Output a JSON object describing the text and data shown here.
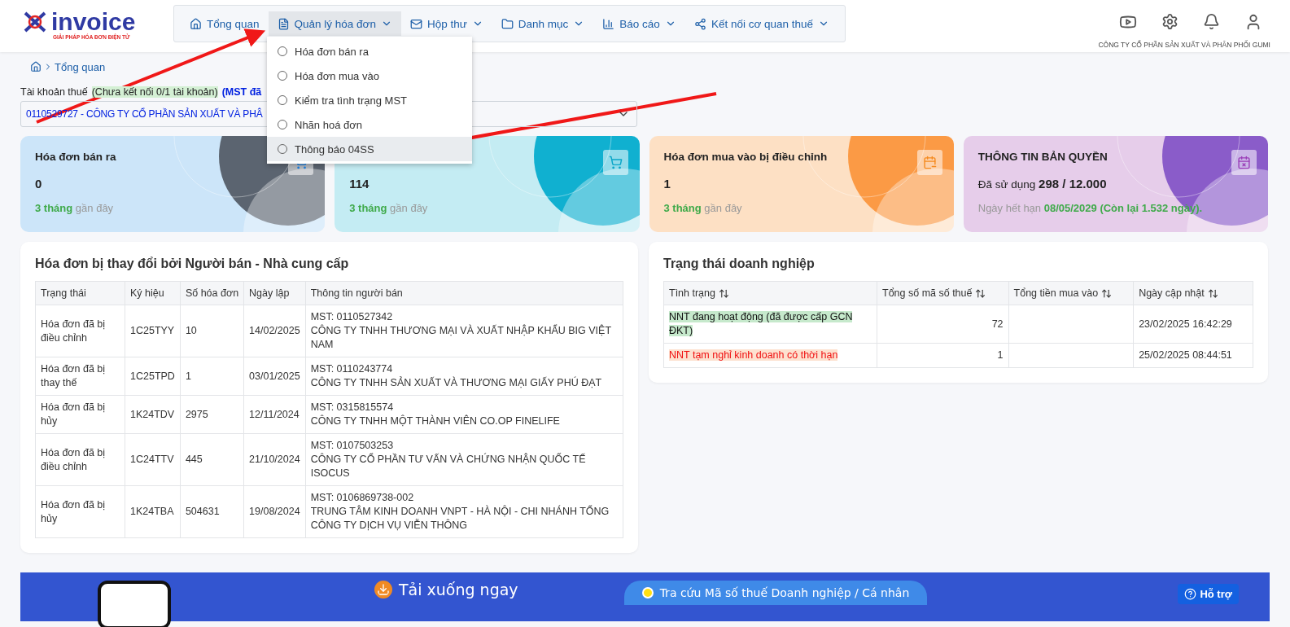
{
  "logo": {
    "name": "invoice",
    "tagline": "GIẢI PHÁP HÓA ĐƠN ĐIỆN TỬ"
  },
  "nav": [
    {
      "label": "Tổng quan",
      "selected": false,
      "dropdown": false
    },
    {
      "label": "Quản lý hóa đơn",
      "selected": true,
      "dropdown": true
    },
    {
      "label": "Hộp thư",
      "selected": false,
      "dropdown": true
    },
    {
      "label": "Danh mục",
      "selected": false,
      "dropdown": true
    },
    {
      "label": "Báo cáo",
      "selected": false,
      "dropdown": true
    },
    {
      "label": "Kết nối cơ quan thuế",
      "selected": false,
      "dropdown": true
    }
  ],
  "dropdown_menu": [
    {
      "label": "Hóa đơn bán ra",
      "selected": false
    },
    {
      "label": "Hóa đơn mua vào",
      "selected": false
    },
    {
      "label": "Kiểm tra tình trạng MST",
      "selected": false
    },
    {
      "label": "Nhãn hoá đơn",
      "selected": false
    },
    {
      "label": "Thông báo 04SS",
      "selected": true
    }
  ],
  "company_name": "CÔNG TY CỔ PHẦN SẢN XUẤT VÀ PHÂN PHỐI GUMI",
  "breadcrumb": "Tổng quan",
  "tax_account": {
    "label": "Tài khoản thuế",
    "connection": "(Chưa kết nối 0/1 tài khoản)",
    "mst_note": "(MST đã",
    "value": "0110529727 - CÔNG TY CỔ PHẦN SẢN XUẤT VÀ PHÂ"
  },
  "cards": [
    {
      "title": "Hóa đơn bán ra",
      "value": "0",
      "footer_highlight": "3 tháng",
      "footer_text": "gần đây",
      "color": "#cce5f9"
    },
    {
      "value": "114",
      "footer_highlight": "3 tháng",
      "footer_text": "gần đây",
      "color": "#c4ecf3"
    },
    {
      "title": "Hóa đơn mua vào bị điều chỉnh",
      "value": "1",
      "footer_highlight": "3 tháng",
      "footer_text": "gần đây",
      "color": "#fde0c4"
    },
    {
      "title": "THÔNG TIN BẢN QUYỀN",
      "value_prefix": "Đã sử dụng",
      "value": "298 / 12.000",
      "footer_text": "Ngày hết hạn",
      "footer_highlight": "08/05/2029 (Còn lại 1.532 ngày).",
      "color": "#e6cdea"
    }
  ],
  "changed_invoices": {
    "title": "Hóa đơn bị thay đổi bởi Người bán - Nhà cung cấp",
    "columns": [
      "Trạng thái",
      "Ký hiệu",
      "Số hóa đơn",
      "Ngày lập",
      "Thông tin người bán"
    ],
    "rows": [
      {
        "status": "Hóa đơn đã bị điều chỉnh",
        "symbol": "1C25TYY",
        "number": "10",
        "date": "14/02/2025",
        "mst": "MST: 0110527342",
        "seller": "CÔNG TY TNHH THƯƠNG MẠI VÀ XUẤT NHẬP KHẨU BIG VIỆT NAM"
      },
      {
        "status": "Hóa đơn đã bị thay thế",
        "symbol": "1C25TPD",
        "number": "1",
        "date": "03/01/2025",
        "mst": "MST: 0110243774",
        "seller": "CÔNG TY TNHH SẢN XUẤT VÀ THƯƠNG MẠI GIẤY PHÚ ĐẠT"
      },
      {
        "status": "Hóa đơn đã bị hủy",
        "symbol": "1K24TDV",
        "number": "2975",
        "date": "12/11/2024",
        "mst": "MST: 0315815574",
        "seller": "CÔNG TY TNHH MỘT THÀNH VIÊN CO.OP FINELIFE"
      },
      {
        "status": "Hóa đơn đã bị điều chỉnh",
        "symbol": "1C24TTV",
        "number": "445",
        "date": "21/10/2024",
        "mst": "MST: 0107503253",
        "seller": "CÔNG TY CỔ PHẦN TƯ VẤN VÀ CHỨNG NHẬN QUỐC TẾ ISOCUS"
      },
      {
        "status": "Hóa đơn đã bị hủy",
        "symbol": "1K24TBA",
        "number": "504631",
        "date": "19/08/2024",
        "mst": "MST: 0106869738-002",
        "seller": "TRUNG TÂM KINH DOANH VNPT - HÀ NỘI - CHI NHÁNH TỔNG CÔNG TY DỊCH VỤ VIỄN THÔNG"
      }
    ]
  },
  "business_status": {
    "title": "Trạng thái doanh nghiệp",
    "columns": [
      "Tình trạng",
      "Tổng số mã số thuế",
      "Tổng tiền mua vào",
      "Ngày cập nhật"
    ],
    "rows": [
      {
        "kind": "active",
        "status": "NNT đang hoạt động (đã được cấp GCN ĐKT)",
        "count": "72",
        "updated": "23/02/2025 16:42:29"
      },
      {
        "kind": "suspended",
        "status": "NNT tạm nghỉ kinh doanh có thời hạn",
        "count": "1",
        "updated": "25/02/2025 08:44:51"
      }
    ]
  },
  "banner": {
    "download": "Tải xuống ngay",
    "lookup": "Tra cứu Mã số thuế Doanh nghiệp / Cá nhân"
  },
  "help_button": "Hỗ trợ"
}
